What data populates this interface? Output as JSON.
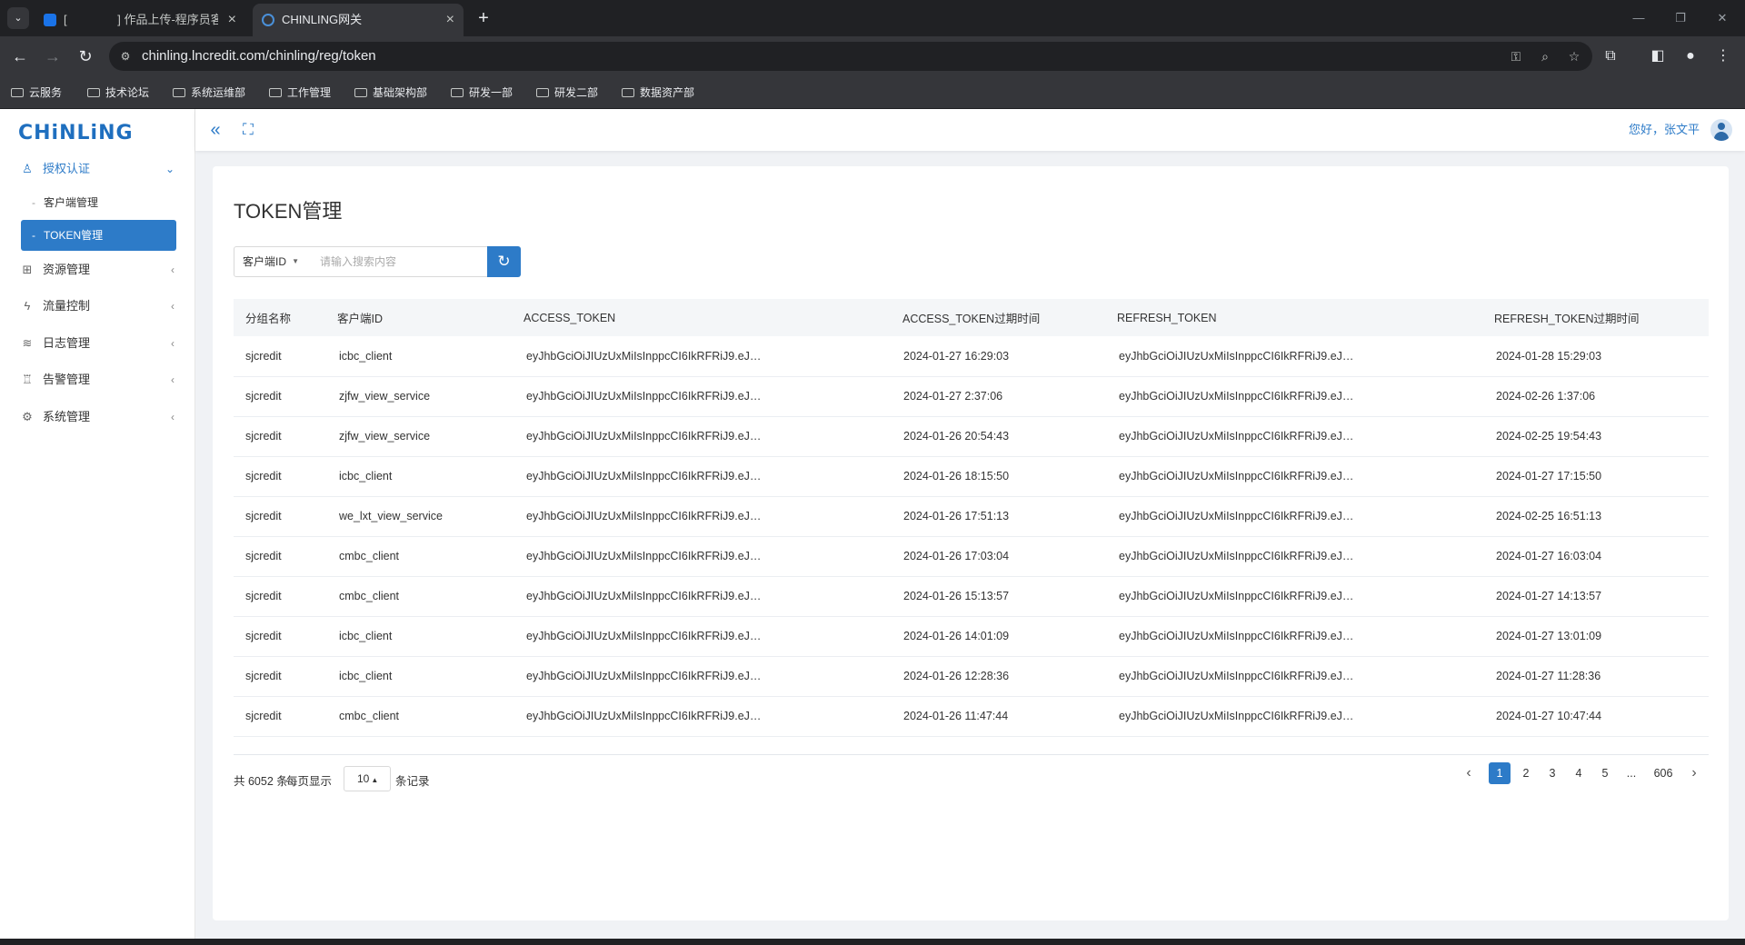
{
  "browser": {
    "tabs": [
      {
        "title": "[ 　　　　] 作品上传-程序员客栈",
        "active": false,
        "favicon_color": "#1a73e8"
      },
      {
        "title": "CHINLING网关",
        "active": true,
        "favicon_color": "#4a90d9"
      }
    ],
    "new_tab": "+",
    "close_glyph": "×",
    "window_controls": {
      "minimize": "—",
      "restore": "❐",
      "close": "✕"
    },
    "url": "chinling.lncredit.com/chinling/reg/token",
    "bookmarks": [
      "云服务",
      "技术论坛",
      "系统运维部",
      "工作管理",
      "基础架构部",
      "研发一部",
      "研发二部",
      "数据资产部"
    ]
  },
  "app": {
    "logo": "CHiNLiNG",
    "greeting": "您好，张文平",
    "sidebar": {
      "groups": [
        {
          "label": "授权认证",
          "icon": "user-icon",
          "glyph": "♙",
          "arrow": "⌄",
          "open": true,
          "children": [
            {
              "label": "客户端管理",
              "active": false
            },
            {
              "label": "TOKEN管理",
              "active": true
            }
          ]
        },
        {
          "label": "资源管理",
          "icon": "grid-icon",
          "glyph": "⊞",
          "arrow": "‹"
        },
        {
          "label": "流量控制",
          "icon": "bolt-icon",
          "glyph": "ϟ",
          "arrow": "‹"
        },
        {
          "label": "日志管理",
          "icon": "layers-icon",
          "glyph": "≋",
          "arrow": "‹"
        },
        {
          "label": "告警管理",
          "icon": "alarm-icon",
          "glyph": "♖",
          "arrow": "‹"
        },
        {
          "label": "系统管理",
          "icon": "gear-icon",
          "glyph": "⚙",
          "arrow": "‹"
        }
      ]
    },
    "topbar": {
      "collapse_glyph": "«",
      "fullscreen_glyph": "⛶"
    },
    "page": {
      "title": "TOKEN管理",
      "search": {
        "field_select": "客户端ID",
        "placeholder": "请输入搜索内容",
        "value": "",
        "refresh_glyph": "↻"
      },
      "table": {
        "columns": [
          "分组名称",
          "客户端ID",
          "ACCESS_TOKEN",
          "ACCESS_TOKEN过期时间",
          "REFRESH_TOKEN",
          "REFRESH_TOKEN过期时间"
        ],
        "rows": [
          [
            "sjcredit",
            "icbc_client",
            "eyJhbGciOiJIUzUxMiIsInppcCI6IkRFRiJ9.eJ…",
            "2024-01-27 16:29:03",
            "eyJhbGciOiJIUzUxMiIsInppcCI6IkRFRiJ9.eJ…",
            "2024-01-28 15:29:03"
          ],
          [
            "sjcredit",
            "zjfw_view_service",
            "eyJhbGciOiJIUzUxMiIsInppcCI6IkRFRiJ9.eJ…",
            "2024-01-27 2:37:06",
            "eyJhbGciOiJIUzUxMiIsInppcCI6IkRFRiJ9.eJ…",
            "2024-02-26 1:37:06"
          ],
          [
            "sjcredit",
            "zjfw_view_service",
            "eyJhbGciOiJIUzUxMiIsInppcCI6IkRFRiJ9.eJ…",
            "2024-01-26 20:54:43",
            "eyJhbGciOiJIUzUxMiIsInppcCI6IkRFRiJ9.eJ…",
            "2024-02-25 19:54:43"
          ],
          [
            "sjcredit",
            "icbc_client",
            "eyJhbGciOiJIUzUxMiIsInppcCI6IkRFRiJ9.eJ…",
            "2024-01-26 18:15:50",
            "eyJhbGciOiJIUzUxMiIsInppcCI6IkRFRiJ9.eJ…",
            "2024-01-27 17:15:50"
          ],
          [
            "sjcredit",
            "we_lxt_view_service",
            "eyJhbGciOiJIUzUxMiIsInppcCI6IkRFRiJ9.eJ…",
            "2024-01-26 17:51:13",
            "eyJhbGciOiJIUzUxMiIsInppcCI6IkRFRiJ9.eJ…",
            "2024-02-25 16:51:13"
          ],
          [
            "sjcredit",
            "cmbc_client",
            "eyJhbGciOiJIUzUxMiIsInppcCI6IkRFRiJ9.eJ…",
            "2024-01-26 17:03:04",
            "eyJhbGciOiJIUzUxMiIsInppcCI6IkRFRiJ9.eJ…",
            "2024-01-27 16:03:04"
          ],
          [
            "sjcredit",
            "cmbc_client",
            "eyJhbGciOiJIUzUxMiIsInppcCI6IkRFRiJ9.eJ…",
            "2024-01-26 15:13:57",
            "eyJhbGciOiJIUzUxMiIsInppcCI6IkRFRiJ9.eJ…",
            "2024-01-27 14:13:57"
          ],
          [
            "sjcredit",
            "icbc_client",
            "eyJhbGciOiJIUzUxMiIsInppcCI6IkRFRiJ9.eJ…",
            "2024-01-26 14:01:09",
            "eyJhbGciOiJIUzUxMiIsInppcCI6IkRFRiJ9.eJ…",
            "2024-01-27 13:01:09"
          ],
          [
            "sjcredit",
            "icbc_client",
            "eyJhbGciOiJIUzUxMiIsInppcCI6IkRFRiJ9.eJ…",
            "2024-01-26 12:28:36",
            "eyJhbGciOiJIUzUxMiIsInppcCI6IkRFRiJ9.eJ…",
            "2024-01-27 11:28:36"
          ],
          [
            "sjcredit",
            "cmbc_client",
            "eyJhbGciOiJIUzUxMiIsInppcCI6IkRFRiJ9.eJ…",
            "2024-01-26 11:47:44",
            "eyJhbGciOiJIUzUxMiIsInppcCI6IkRFRiJ9.eJ…",
            "2024-01-27 10:47:44"
          ]
        ]
      },
      "footer": {
        "total": "共 6052 条",
        "per_page_label": "每页显示",
        "page_size": "10",
        "records_label": "条记录"
      },
      "pagination": {
        "prev": "‹",
        "pages": [
          "1",
          "2",
          "3",
          "4",
          "5",
          "...",
          "606"
        ],
        "current": "1",
        "next": "›"
      }
    }
  },
  "colors": {
    "accent": "#2d7bc8",
    "chrome_dark": "#202124",
    "chrome_mid": "#35363a"
  }
}
